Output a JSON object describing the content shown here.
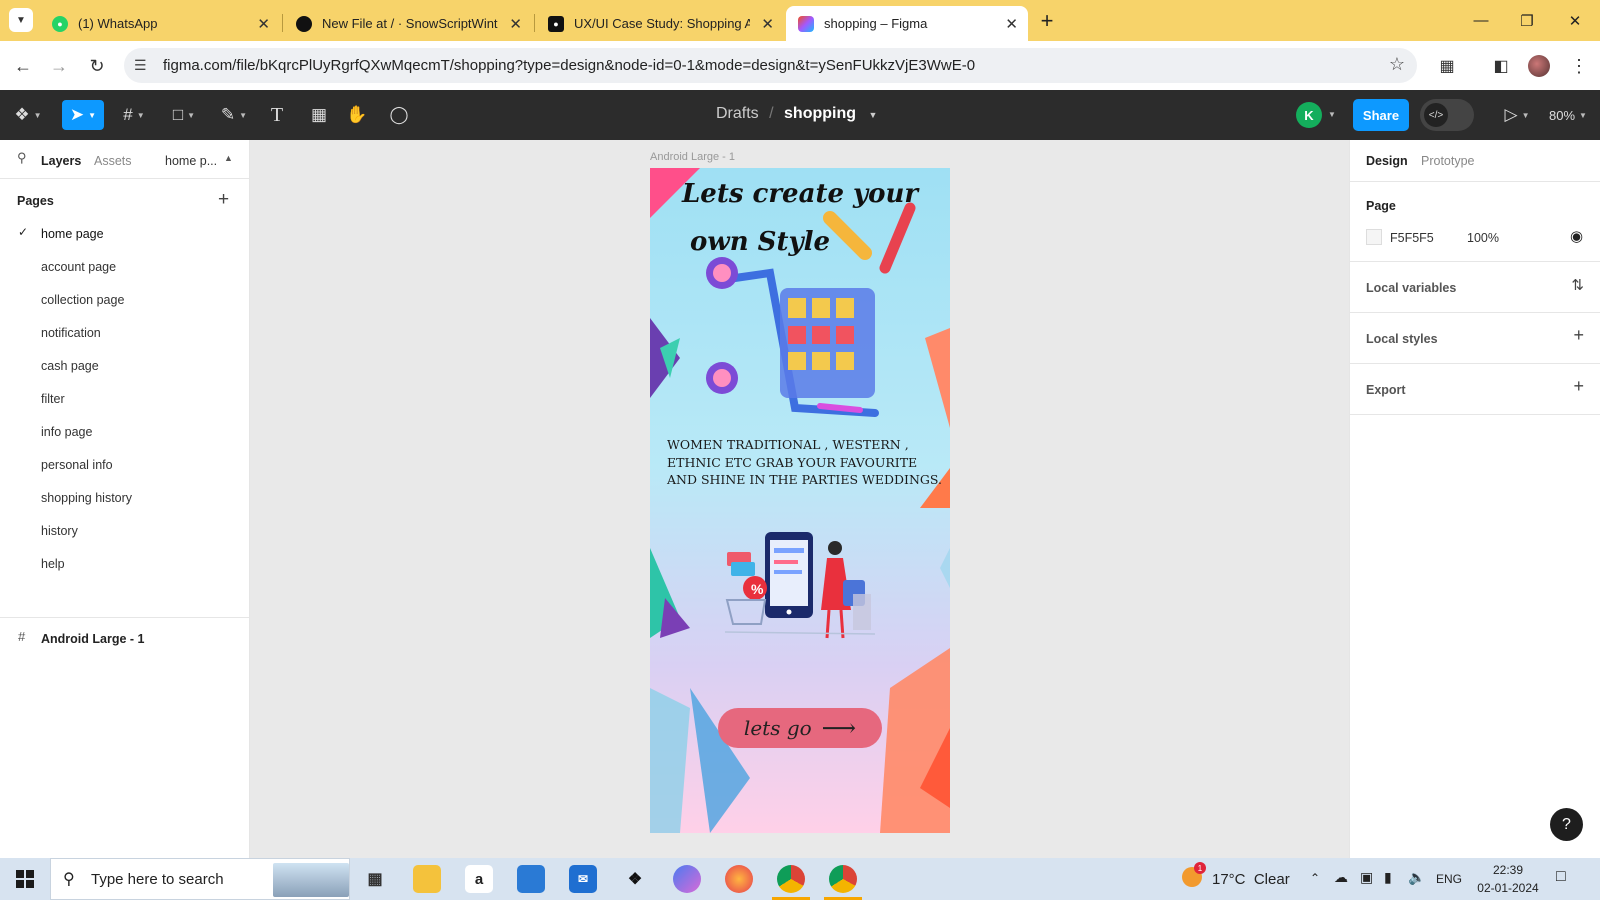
{
  "browser": {
    "tabs": [
      {
        "title": "(1) WhatsApp",
        "icon": "whatsapp-icon",
        "color": "#25d366"
      },
      {
        "title": "New File at / · SnowScriptWinte",
        "icon": "github-icon",
        "color": "#111111"
      },
      {
        "title": "UX/UI Case Study: Shopping Ap",
        "icon": "medium-icon",
        "color": "#111111"
      },
      {
        "title": "shopping – Figma",
        "icon": "figma-icon",
        "color": "#f24e1e"
      }
    ],
    "url": "figma.com/file/bKqrcPlUyRgrfQXwMqecmT/shopping?type=design&node-id=0-1&mode=design&t=ySenFUkkzVjE3WwE-0"
  },
  "figma": {
    "breadcrumb_parent": "Drafts",
    "separator": "/",
    "file_name": "shopping",
    "avatar_letter": "K",
    "share_label": "Share",
    "zoom": "80%",
    "accent": "#0d99ff"
  },
  "left_panel": {
    "tab_layers": "Layers",
    "tab_assets": "Assets",
    "current_page": "home p...",
    "pages_header": "Pages",
    "pages": [
      "home page",
      "account page",
      "collection page",
      "notification",
      "cash page",
      "filter",
      "info page",
      "personal info",
      "shopping history",
      "history",
      "help"
    ],
    "layer": "Android Large - 1"
  },
  "canvas": {
    "frame_label": "Android Large - 1",
    "headline_line1": "Lets create your",
    "headline_line2": "own Style",
    "body_text": "WOMEN TRADITIONAL , WESTERN , ETHNIC ETC GRAB YOUR FAVOURITE AND SHINE IN THE PARTIES WEDDINGS.",
    "badge": "%",
    "cta_label": "lets go"
  },
  "right_panel": {
    "tab_design": "Design",
    "tab_prototype": "Prototype",
    "page_header": "Page",
    "page_color": "F5F5F5",
    "page_opacity": "100%",
    "local_variables": "Local variables",
    "local_styles": "Local styles",
    "export": "Export",
    "help": "?"
  },
  "taskbar": {
    "search_placeholder": "Type here to search",
    "weather": "17°C  Clear",
    "weather_badge": "1",
    "language": "ENG",
    "time": "22:39",
    "date": "02-01-2024"
  }
}
